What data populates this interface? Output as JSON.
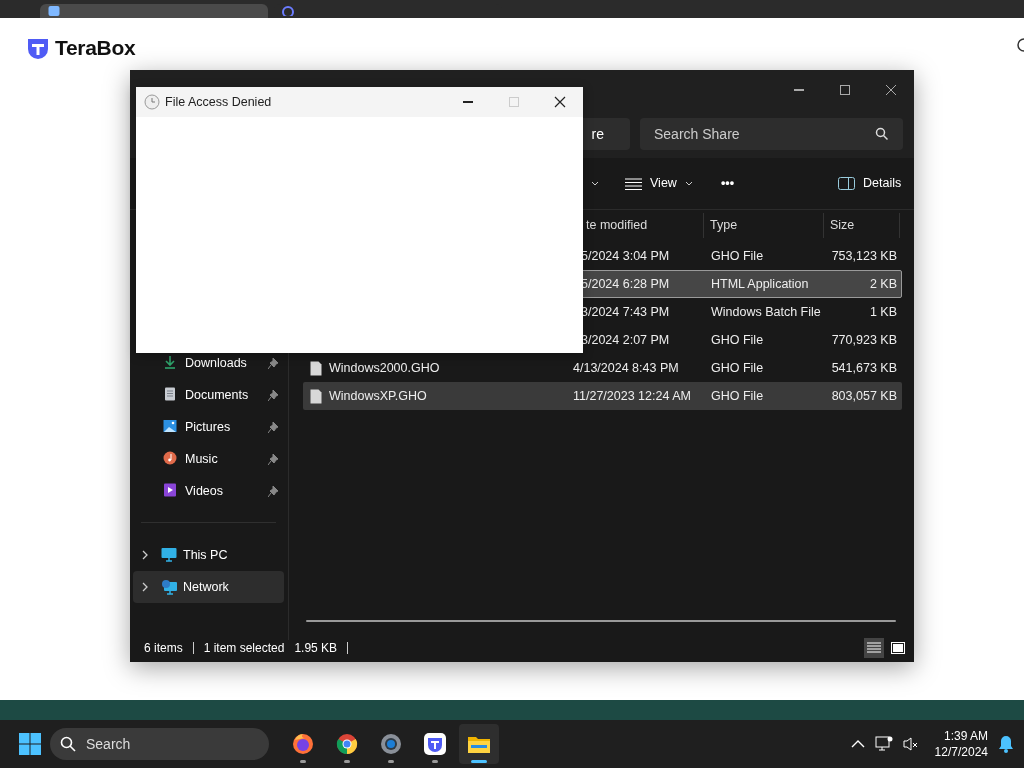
{
  "browser": {
    "tabs": [
      {
        "selected": true
      },
      {
        "selected": false
      }
    ]
  },
  "page": {
    "logo": "TeraBox"
  },
  "explorer": {
    "address_fragment": "re",
    "search": {
      "placeholder": "Search Share"
    },
    "commands": [
      {
        "kind": "dropdown"
      },
      {
        "kind": "view",
        "label": "View"
      },
      {
        "kind": "more",
        "label": "•••"
      },
      {
        "kind": "details",
        "label": "Details"
      }
    ],
    "sidebar": {
      "pinned": [
        {
          "label": "Downloads",
          "kind": "download"
        },
        {
          "label": "Documents",
          "kind": "document"
        },
        {
          "label": "Pictures",
          "kind": "picture"
        },
        {
          "label": "Music",
          "kind": "music"
        },
        {
          "label": "Videos",
          "kind": "video"
        }
      ],
      "locations": [
        {
          "label": "This PC",
          "kind": "pc",
          "selected": false
        },
        {
          "label": "Network",
          "kind": "network",
          "selected": true
        }
      ]
    },
    "columns": [
      "te modified",
      "Type",
      "Size"
    ],
    "files": [
      {
        "date": "5/2024 3:04 PM",
        "type": "GHO File",
        "size": "753,123 KB",
        "selected": false,
        "hovered": false
      },
      {
        "date": "5/2024 6:28 PM",
        "type": "HTML Application",
        "size": "2 KB",
        "selected": true,
        "hovered": false
      },
      {
        "date": "3/2024 7:43 PM",
        "type": "Windows Batch File",
        "size": "1 KB",
        "selected": false,
        "hovered": false
      },
      {
        "date": "3/2024 2:07 PM",
        "type": "GHO File",
        "size": "770,923 KB",
        "selected": false,
        "hovered": false
      },
      {
        "name": "Windows2000.GHO",
        "date": "4/13/2024 8:43 PM",
        "type": "GHO File",
        "size": "541,673 KB",
        "selected": false,
        "hovered": false
      },
      {
        "name": "WindowsXP.GHO",
        "date": "11/27/2023 12:24 AM",
        "type": "GHO File",
        "size": "803,057 KB",
        "selected": false,
        "hovered": true
      }
    ],
    "status": {
      "count": "6 items",
      "selection": "1 item selected",
      "size": "1.95 KB"
    },
    "view_modes": [
      {
        "kind": "details",
        "selected": true
      },
      {
        "kind": "tiles",
        "selected": false
      }
    ]
  },
  "dialog": {
    "title": "File Access Denied"
  },
  "taskbar": {
    "search_placeholder": "Search",
    "apps": [
      {
        "kind": "firefox",
        "active": false
      },
      {
        "kind": "chrome",
        "active": false
      },
      {
        "kind": "settings",
        "active": false
      },
      {
        "kind": "terabox",
        "active": false
      },
      {
        "kind": "explorer",
        "active": true
      }
    ],
    "time": "1:39 AM",
    "date": "12/7/2024"
  }
}
